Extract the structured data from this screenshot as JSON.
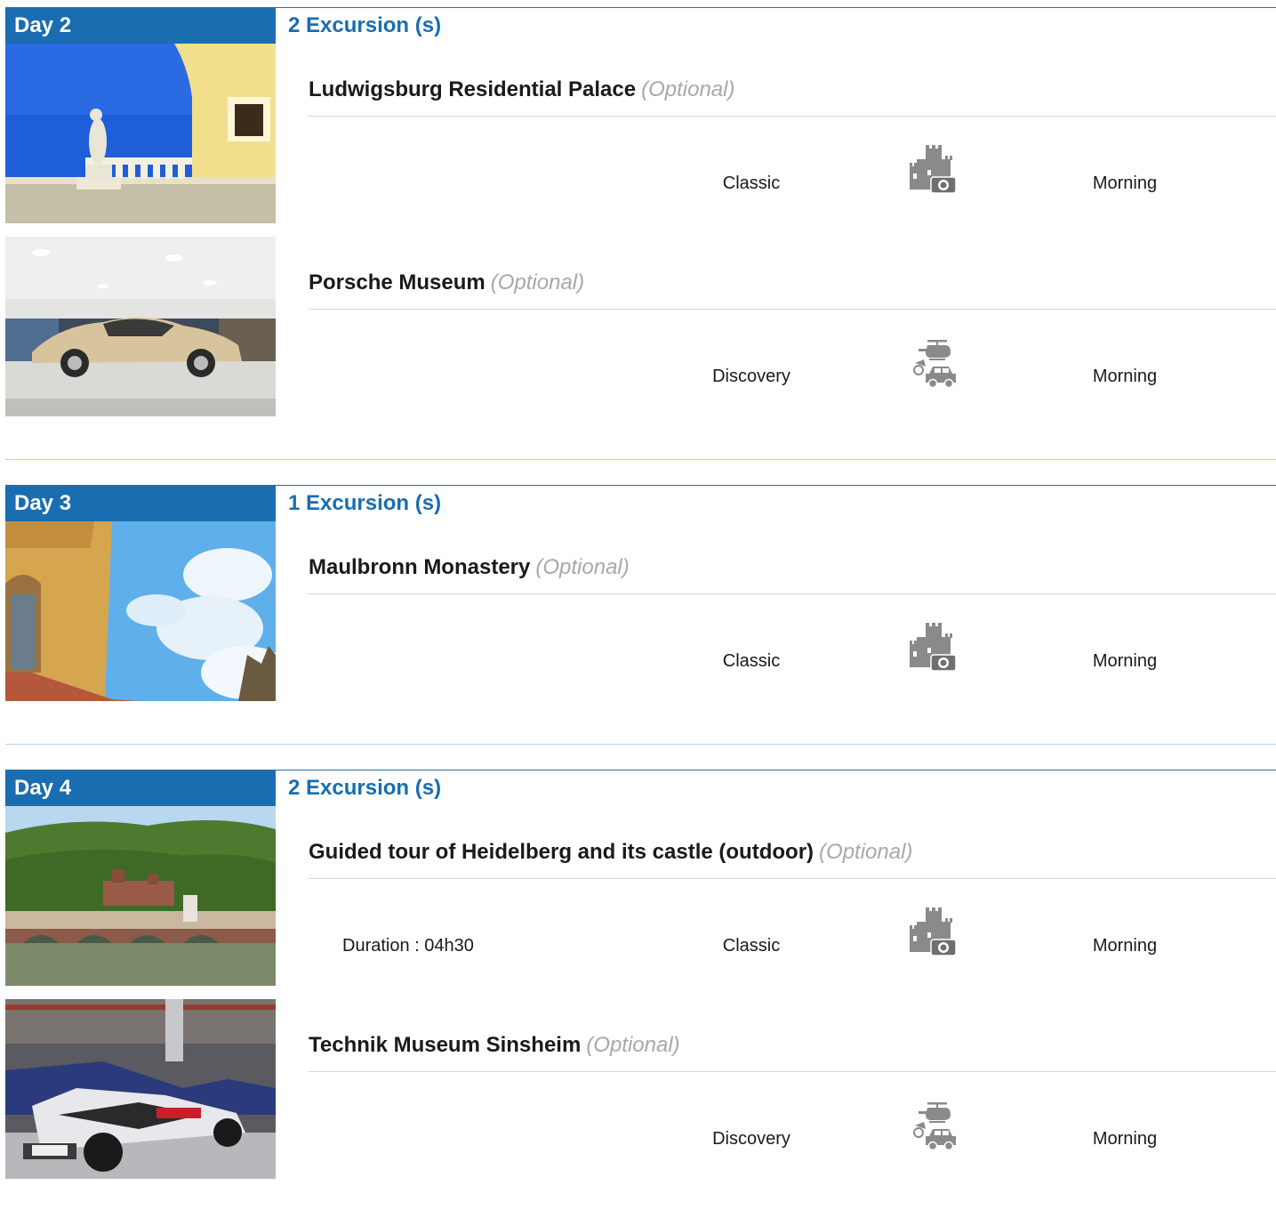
{
  "days": [
    {
      "label": "Day 2",
      "count": "2 Excursion (s)",
      "excursions": [
        {
          "title": "Ludwigsburg Residential Palace",
          "optional": "(Optional)",
          "duration": "",
          "type": "Classic",
          "icon": "castle-camera-icon",
          "time": "Morning"
        },
        {
          "title": "Porsche Museum",
          "optional": "(Optional)",
          "duration": "",
          "type": "Discovery",
          "icon": "helicopter-car-icon",
          "time": "Morning"
        }
      ]
    },
    {
      "label": "Day 3",
      "count": "1 Excursion (s)",
      "excursions": [
        {
          "title": "Maulbronn Monastery",
          "optional": "(Optional)",
          "duration": "",
          "type": "Classic",
          "icon": "castle-camera-icon",
          "time": "Morning"
        }
      ]
    },
    {
      "label": "Day 4",
      "count": "2 Excursion (s)",
      "excursions": [
        {
          "title": "Guided tour of Heidelberg and its castle (outdoor)",
          "optional": "(Optional)",
          "duration": "Duration : 04h30",
          "type": "Classic",
          "icon": "castle-camera-icon",
          "time": "Morning"
        },
        {
          "title": "Technik Museum Sinsheim",
          "optional": "(Optional)",
          "duration": "",
          "type": "Discovery",
          "icon": "helicopter-car-icon",
          "time": "Morning"
        }
      ]
    }
  ],
  "colors": {
    "accent": "#1a6db0",
    "optional": "#a8a8a8"
  }
}
